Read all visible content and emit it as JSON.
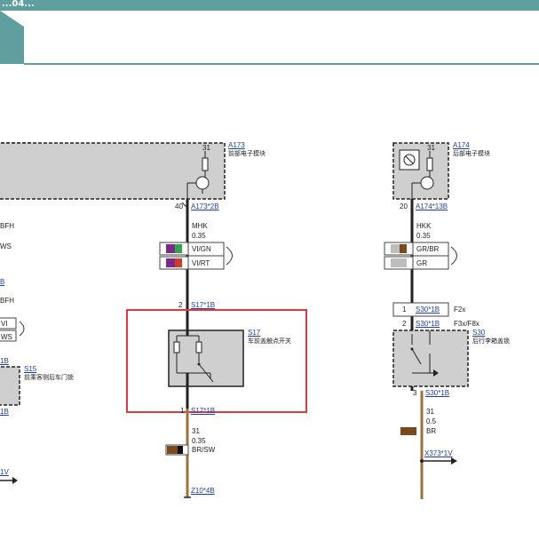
{
  "header": {
    "title": "...04..."
  },
  "left": {
    "labels": [
      "BFH",
      "WS",
      "B",
      "BFH",
      "VI",
      "WS",
      "1B",
      "1B",
      "1V"
    ],
    "s15": {
      "id": "S15",
      "desc": "前乘客侧后车门锁"
    }
  },
  "center": {
    "a173": {
      "id": "A173",
      "desc": "前部电子模块",
      "pin_top": "31",
      "pin": "40",
      "conn": "A173*2B"
    },
    "wire1": {
      "name": "MHK",
      "size": "0.35",
      "c1": "VI/GN",
      "c2": "VI/RT"
    },
    "s17_pin": "2",
    "s17_conn": "S17*1B",
    "s17": {
      "id": "S17",
      "desc": "车前盖触点开关"
    },
    "below_pin": "1",
    "below_conn": "S17*1B",
    "wire2": {
      "name": "31",
      "size": "0.35",
      "color": "BR/SW"
    },
    "ground": "Z10*4B"
  },
  "right": {
    "a174": {
      "id": "A174",
      "desc": "后部电子模块",
      "pin_top": "31",
      "pin": "20",
      "conn": "A174*13B"
    },
    "wire1": {
      "name": "HKK",
      "size": "0.35",
      "c1": "GR/BR",
      "c2": "GR"
    },
    "s30_conn1": {
      "pin": "1",
      "conn": "S30*1B",
      "f": "F2x"
    },
    "s30_conn2": {
      "pin": "2",
      "conn": "S30*1B",
      "f": "F3x/F8x"
    },
    "s30": {
      "id": "S30",
      "desc": "后行李箱盖锁"
    },
    "below_pin": "3",
    "below_conn": "S30*1B",
    "wire2": {
      "name": "31",
      "size": "0.5",
      "color": "BR"
    },
    "ground": "X373*1V"
  },
  "colors": {
    "header": "#5f9fa0",
    "highlight": "#e0393e",
    "wire": "#a0703a",
    "box": "#cfcfcf"
  }
}
